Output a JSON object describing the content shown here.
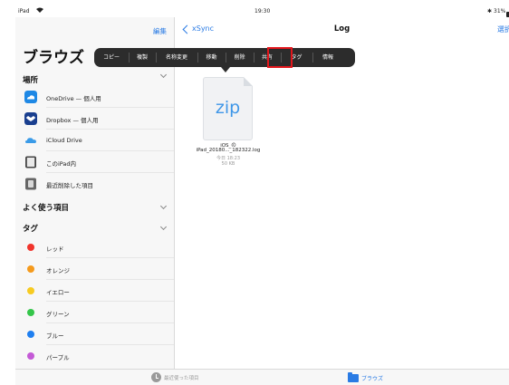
{
  "status_bar": {
    "device": "iPad",
    "time": "19:30",
    "battery": "31%"
  },
  "sidebar": {
    "edit_label": "編集",
    "title": "ブラウズ",
    "locations_header": "場所",
    "locations": [
      {
        "label": "OneDrive — 個人用",
        "icon": "onedrive-icon",
        "color": "#1e88e5"
      },
      {
        "label": "Dropbox — 個人用",
        "icon": "dropbox-icon",
        "color": "#1a3f8f"
      },
      {
        "label": "iCloud Drive",
        "icon": "icloud-icon",
        "color": "#3a9be8"
      },
      {
        "label": "このiPad内",
        "icon": "ipad-icon",
        "color": "#555555"
      },
      {
        "label": "最近削除した項目",
        "icon": "trash-icon",
        "color": "#777777"
      }
    ],
    "favorites_header": "よく使う項目",
    "tags_header": "タグ",
    "tags": [
      {
        "label": "レッド",
        "color": "#f1342c"
      },
      {
        "label": "オレンジ",
        "color": "#f59a1c"
      },
      {
        "label": "イエロー",
        "color": "#f7cb21"
      },
      {
        "label": "グリーン",
        "color": "#35c64a"
      },
      {
        "label": "ブルー",
        "color": "#1f7ff0"
      },
      {
        "label": "パープル",
        "color": "#c45ad6"
      }
    ]
  },
  "nav": {
    "back_label": "xSync",
    "title": "Log",
    "select_label": "選択"
  },
  "context_menu": {
    "items": [
      "コピー",
      "複製",
      "名称変更",
      "移動",
      "削除",
      "共有",
      "タグ",
      "情報"
    ],
    "highlighted": "共有",
    "highlight_color": "#e3161c"
  },
  "file": {
    "extension": "zip",
    "name_line1": "iOS_の",
    "name_line2": "iPad_20180..._182322.log",
    "date": "今日 18:23",
    "size": "50 KB"
  },
  "tab_bar": {
    "recent_label": "最近使った項目",
    "browse_label": "ブラウズ"
  }
}
